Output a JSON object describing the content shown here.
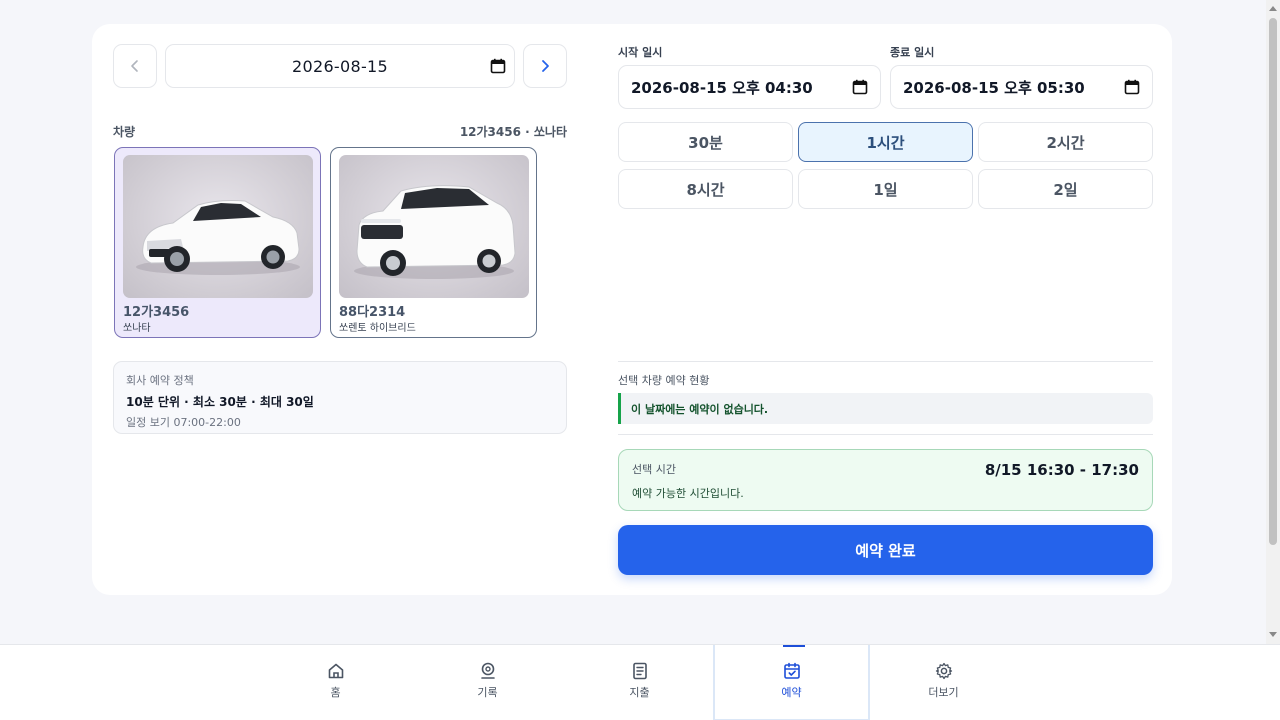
{
  "date_nav": {
    "date": "2026-08-15"
  },
  "vehicle": {
    "label": "차량",
    "selected_summary": "12가3456 · 쏘나타",
    "cards": [
      {
        "plate": "12가3456",
        "model": "쏘나타",
        "selected": true
      },
      {
        "plate": "88다2314",
        "model": "쏘렌토 하이브리드",
        "selected": false
      }
    ]
  },
  "policy": {
    "title": "회사 예약 정책",
    "main": "10분 단위 · 최소 30분 · 최대 30일",
    "sub": "일정 보기 07:00-22:00"
  },
  "start": {
    "label": "시작 일시",
    "value": "2026-08-15 오후 04:30"
  },
  "end": {
    "label": "종료 일시",
    "value": "2026-08-15 오후 05:30"
  },
  "durations": [
    "30분",
    "1시간",
    "2시간",
    "8시간",
    "1일",
    "2일"
  ],
  "durations_selected": "1시간",
  "status": {
    "label": "선택 차량 예약 현황",
    "message": "이 날짜에는 예약이 없습니다."
  },
  "selection": {
    "label": "선택 시간",
    "range": "8/15 16:30 - 17:30",
    "note": "예약 가능한 시간입니다."
  },
  "submit_label": "예약 완료",
  "bottom_nav": [
    {
      "label": "홈",
      "icon": "home-icon"
    },
    {
      "label": "기록",
      "icon": "map-pin-icon"
    },
    {
      "label": "지출",
      "icon": "receipt-icon"
    },
    {
      "label": "예약",
      "icon": "calendar-check-icon",
      "active": true
    },
    {
      "label": "더보기",
      "icon": "gear-icon"
    }
  ],
  "colors": {
    "accent": "#2563eb",
    "selected_bg": "#e8f4fe",
    "success": "#16a34a"
  }
}
